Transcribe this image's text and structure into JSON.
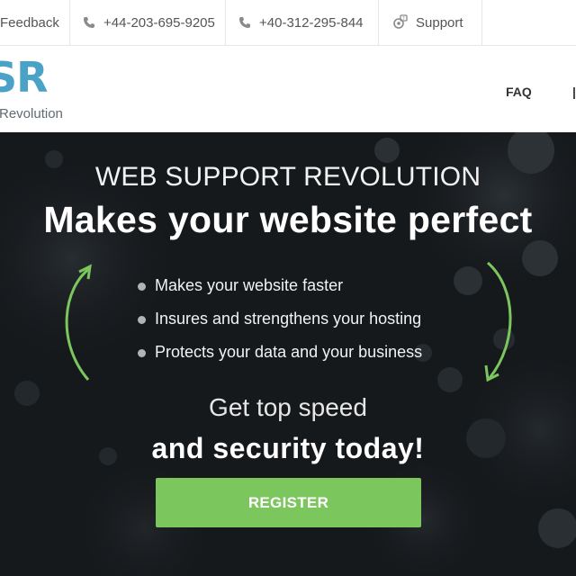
{
  "topbar": {
    "feedback": "Feedback",
    "phone1": "+44-203-695-9205",
    "phone2": "+40-312-295-844",
    "support": "Support",
    "icons": [
      "phone-icon",
      "support-icon"
    ]
  },
  "navbar": {
    "logo_mark": "SR",
    "logo_sub": "Revolution",
    "faq": "FAQ"
  },
  "hero": {
    "kicker": "WEB SUPPORT REVOLUTION",
    "headline": "Makes your website perfect",
    "benefits": [
      "Makes your website faster",
      "Insures and strengthens your hosting",
      "Protects your data and your business"
    ],
    "cta_line1": "Get top speed",
    "cta_line2": "and security today!",
    "register": "REGISTER"
  },
  "colors": {
    "logo": "#4aa3c6",
    "hero_bg": "#16191c",
    "accent_green": "#7cc65e",
    "text_gray": "#555555"
  }
}
